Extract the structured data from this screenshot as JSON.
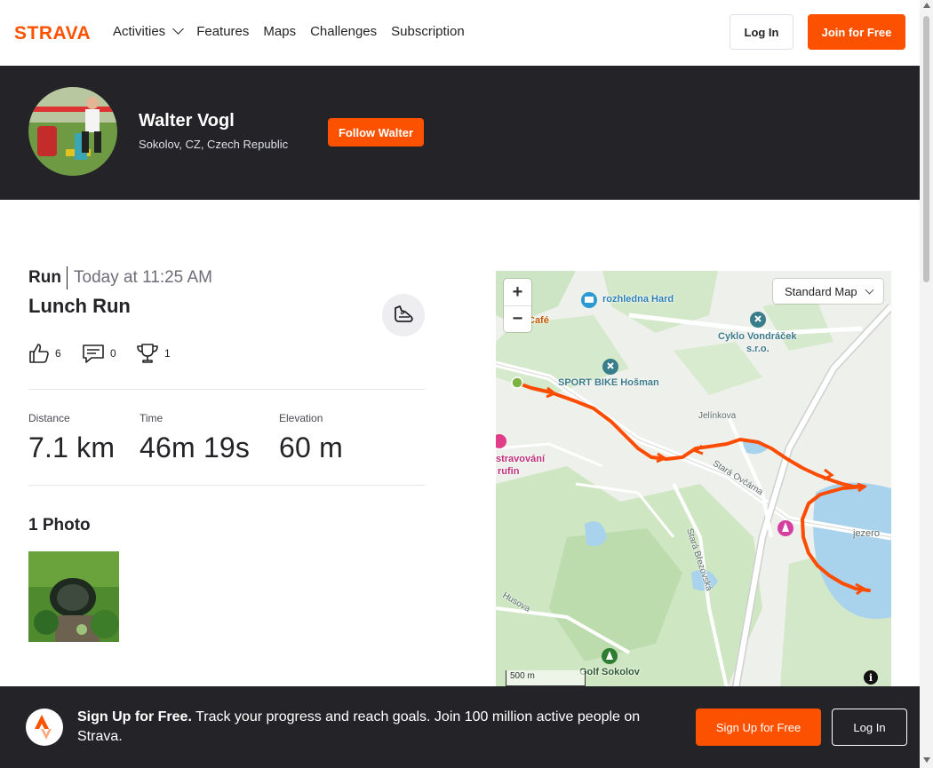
{
  "nav": {
    "logo": "STRAVA",
    "links": [
      "Activities",
      "Features",
      "Maps",
      "Challenges",
      "Subscription"
    ],
    "login_label": "Log In",
    "join_label": "Join for Free"
  },
  "athlete": {
    "name": "Walter Vogl",
    "location": "Sokolov, CZ, Czech Republic",
    "follow_label": "Follow Walter"
  },
  "activity": {
    "type": "Run",
    "date": "Today at 11:25 AM",
    "title": "Lunch Run",
    "sport_icon": "running-shoe-icon",
    "kudos_count": "6",
    "comments_count": "0",
    "achievements_count": "1",
    "stats": [
      {
        "label": "Distance",
        "value": "7.1 km"
      },
      {
        "label": "Time",
        "value": "46m 19s"
      },
      {
        "label": "Elevation",
        "value": "60 m"
      }
    ],
    "photos_heading": "1 Photo"
  },
  "map": {
    "zoom_in": "+",
    "zoom_out": "−",
    "map_type": "Standard Map",
    "labels": {
      "rozhledna": "rozhledna Hard",
      "cyklo1": "Cyklo Vondráček",
      "cyklo2": "s.r.o.",
      "sportbike": "SPORT BIKE Hošman",
      "cafe": "Café",
      "jelinkova": "Jelínkova",
      "stravovani": "stravování",
      "rufin": "rufin",
      "stara_ovcama": "Stará Ovčárna",
      "jezero": "jezero",
      "stara_brezovska": "Stará Březovská",
      "husova": "Husova",
      "golf": "Golf Sokolov"
    },
    "scale": "500 m",
    "info": "i",
    "route_color": "#fc4c02"
  },
  "signup": {
    "bold": "Sign Up for Free.",
    "text": " Track your progress and reach goals. Join 100 million active people on Strava.",
    "signup_label": "Sign Up for Free",
    "login_label": "Log In"
  },
  "colors": {
    "brand": "#fc5200",
    "dark": "#242428"
  }
}
